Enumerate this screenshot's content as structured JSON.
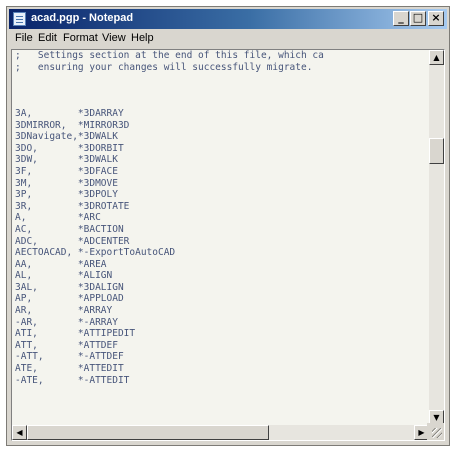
{
  "window": {
    "title": "acad.pgp - Notepad",
    "buttons": {
      "minimize": "_",
      "maximize": "□",
      "close": "×"
    }
  },
  "menu": [
    "File",
    "Edit",
    "Format",
    "View",
    "Help"
  ],
  "editor": {
    "lines": [
      ";   Settings section at the end of this file, which ca",
      ";   ensuring your changes will successfully migrate.",
      "",
      "",
      "",
      "3A,        *3DARRAY",
      "3DMIRROR,  *MIRROR3D",
      "3DNavigate,*3DWALK",
      "3DO,       *3DORBIT",
      "3DW,       *3DWALK",
      "3F,        *3DFACE",
      "3M,        *3DMOVE",
      "3P,        *3DPOLY",
      "3R,        *3DROTATE",
      "A,         *ARC",
      "AC,        *BACTION",
      "ADC,       *ADCENTER",
      "AECTOACAD, *-ExportToAutoCAD",
      "AA,        *AREA",
      "AL,        *ALIGN",
      "3AL,       *3DALIGN",
      "AP,        *APPLOAD",
      "AR,        *ARRAY",
      "-AR,       *-ARRAY",
      "ATI,       *ATTIPEDIT",
      "ATT,       *ATTDEF",
      "-ATT,      *-ATTDEF",
      "ATE,       *ATTEDIT",
      "-ATE,      *-ATTEDIT"
    ]
  },
  "scrollbars": {
    "up_arrow": "▲",
    "down_arrow": "▼",
    "left_arrow": "◀",
    "right_arrow": "▶",
    "icons": [
      "scroll-up-icon",
      "scroll-down-icon",
      "scroll-left-icon",
      "scroll-right-icon"
    ]
  }
}
